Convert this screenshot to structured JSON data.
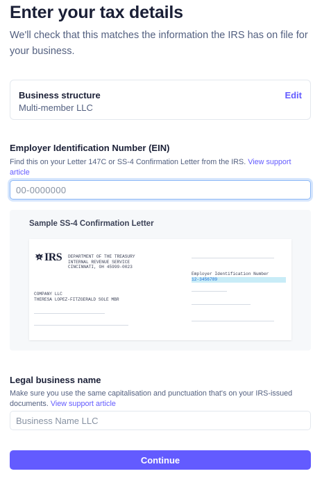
{
  "header": {
    "title": "Enter your tax details",
    "subtitle": "We'll check that this matches the information the IRS has on file for your business."
  },
  "structure": {
    "label": "Business structure",
    "value": "Multi-member LLC",
    "edit_label": "Edit"
  },
  "ein": {
    "label": "Employer Identification Number (EIN)",
    "help": "Find this on your Letter 147C or SS-4 Confirmation Letter from the IRS. ",
    "help_link": "View support article",
    "placeholder": "00-0000000"
  },
  "sample": {
    "title": "Sample SS-4 Confirmation Letter",
    "logo_text": "IRS",
    "treasury_lines": [
      "DEPARTMENT OF THE TREASURY",
      "INTERNAL REVENUE SERVICE",
      "CINCINNATI, OH 45999-0023"
    ],
    "company_lines": [
      "COMPANY LLC",
      "THERESA LOPEZ-FITZGERALD SOLE MBR"
    ],
    "ein_caption": "Employer Identification Number",
    "ein_value": "12-3456789"
  },
  "legal": {
    "label": "Legal business name",
    "help": "Make sure you use the same capitalisation and punctuation that's on your IRS-issued documents. ",
    "help_link": "View support article",
    "placeholder": "Business Name LLC"
  },
  "footer": {
    "continue_label": "Continue"
  },
  "colors": {
    "accent": "#635bff",
    "focus_ring": "#8cb8f6",
    "ein_highlight": "#c8ecf7"
  }
}
